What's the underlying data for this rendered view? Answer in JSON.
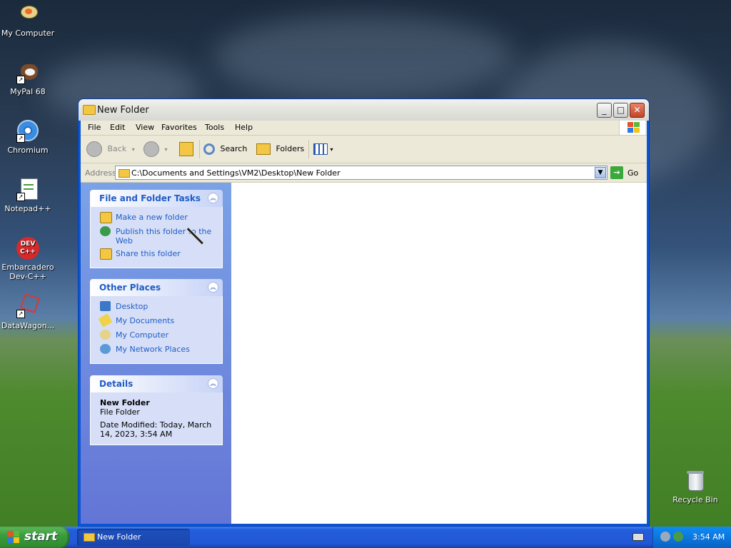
{
  "desktop": {
    "icons": [
      {
        "label": "My Computer"
      },
      {
        "label": "MyPal 68"
      },
      {
        "label": "Chromium"
      },
      {
        "label": "Notepad++"
      },
      {
        "label": "Embarcadero Dev-C++"
      },
      {
        "label": "DataWagon..."
      },
      {
        "label": "Recycle Bin"
      }
    ]
  },
  "window": {
    "title": "New Folder",
    "menu": [
      "File",
      "Edit",
      "View",
      "Favorites",
      "Tools",
      "Help"
    ],
    "toolbar": {
      "back": "Back",
      "search": "Search",
      "folders": "Folders"
    },
    "address": {
      "label": "Address",
      "value": "C:\\Documents and Settings\\VM2\\Desktop\\New Folder",
      "go": "Go"
    },
    "taskpane": {
      "file_tasks": {
        "title": "File and Folder Tasks",
        "items": [
          "Make a new folder",
          "Publish this folder to the Web",
          "Share this folder"
        ]
      },
      "other_places": {
        "title": "Other Places",
        "items": [
          "Desktop",
          "My Documents",
          "My Computer",
          "My Network Places"
        ]
      },
      "details": {
        "title": "Details",
        "name": "New Folder",
        "type": "File Folder",
        "modified": "Date Modified: Today, March 14, 2023, 3:54 AM"
      }
    }
  },
  "taskbar": {
    "start": "start",
    "task_button": "New Folder",
    "clock": "3:54 AM"
  }
}
